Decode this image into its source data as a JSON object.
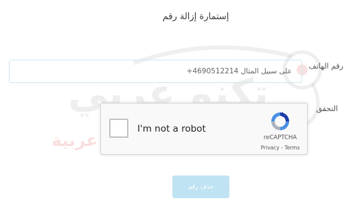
{
  "form": {
    "title": "إستمارة إزالة رقم",
    "phone_label": "رقم الهاتف",
    "phone_value": "",
    "phone_placeholder": "على سبيل المثال 4690512214+",
    "verify_label": "التحقق",
    "submit_label": "حذف رقم"
  },
  "recaptcha": {
    "checkbox_label": "I'm not a robot",
    "checked": false,
    "brand": "reCAPTCHA",
    "links": "Privacy - Terms"
  },
  "watermark": {
    "main_text": "تكنو عربي",
    "sub_text": "تكنولوجيا عالمية بنكهة عربية"
  },
  "colors": {
    "input_border": "#cfe6ee",
    "button_bg": "#bfe3f3",
    "watermark_gray": "#787880",
    "watermark_red": "#d73737"
  }
}
